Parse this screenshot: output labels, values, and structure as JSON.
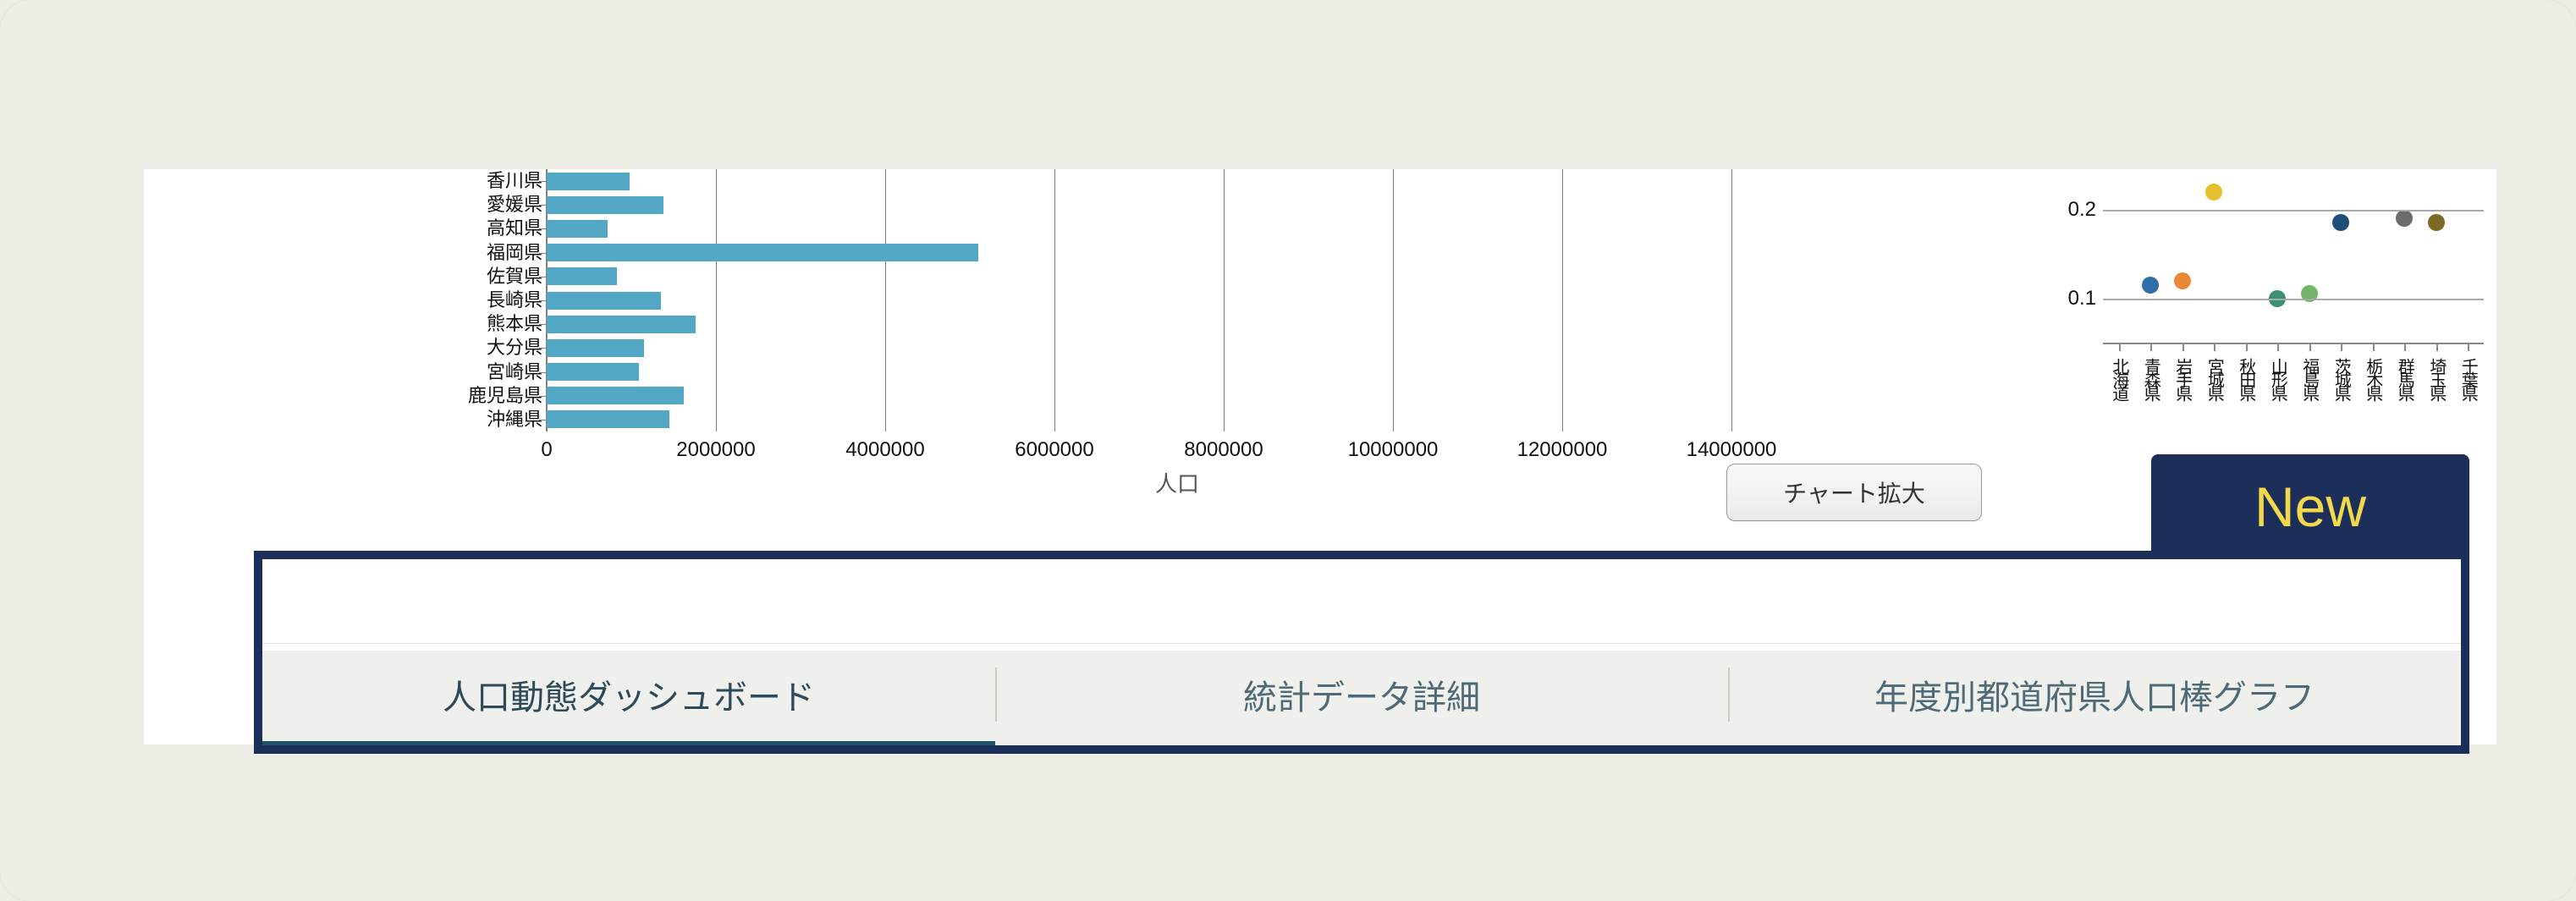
{
  "ui": {
    "expand_button": "チャート拡大",
    "new_badge": "New",
    "tabs": [
      {
        "label": "人口動態ダッシュボード",
        "active": true
      },
      {
        "label": "統計データ詳細",
        "active": false
      },
      {
        "label": "年度別都道府県人口棒グラフ",
        "active": false
      }
    ]
  },
  "chart_data": [
    {
      "type": "bar",
      "orientation": "horizontal",
      "title": "",
      "xlabel": "人口",
      "ylabel": "",
      "xlim": [
        0,
        15000000
      ],
      "xticks": [
        0,
        2000000,
        4000000,
        6000000,
        8000000,
        10000000,
        12000000,
        14000000
      ],
      "note": "Top of chart is clipped in screenshot; only last 11 prefectures visible.",
      "categories": [
        "香川県",
        "愛媛県",
        "高知県",
        "福岡県",
        "佐賀県",
        "長崎県",
        "熊本県",
        "大分県",
        "宮崎県",
        "鹿児島県",
        "沖縄県"
      ],
      "values": [
        980000,
        1380000,
        720000,
        5100000,
        830000,
        1350000,
        1760000,
        1150000,
        1090000,
        1620000,
        1450000
      ],
      "color": "#52a7c4"
    },
    {
      "type": "scatter",
      "title": "",
      "xlabel": "",
      "ylabel": "",
      "ylim": [
        0.05,
        0.25
      ],
      "yticks": [
        0.1,
        0.2
      ],
      "note": "Small cropped scatter panel; one point per visible prefecture. Colors per point.",
      "x_categories": [
        "北海道",
        "青森県",
        "岩手県",
        "宮城県",
        "秋田県",
        "山形県",
        "福島県",
        "茨城県",
        "栃木県",
        "群馬県",
        "埼玉県",
        "千葉県"
      ],
      "series": [
        {
          "name": "",
          "points": [
            {
              "x": "青森県",
              "y": 0.115,
              "color": "#2f6ea8"
            },
            {
              "x": "岩手県",
              "y": 0.12,
              "color": "#e98938"
            },
            {
              "x": "宮城県",
              "y": 0.22,
              "color": "#e8bf2f"
            },
            {
              "x": "山形県",
              "y": 0.1,
              "color": "#3c8f74"
            },
            {
              "x": "福島県",
              "y": 0.105,
              "color": "#74b36b"
            },
            {
              "x": "茨城県",
              "y": 0.185,
              "color": "#1e4e79"
            },
            {
              "x": "群馬県",
              "y": 0.19,
              "color": "#6b6b6b"
            },
            {
              "x": "埼玉県",
              "y": 0.185,
              "color": "#7c6a22"
            }
          ]
        }
      ]
    }
  ]
}
